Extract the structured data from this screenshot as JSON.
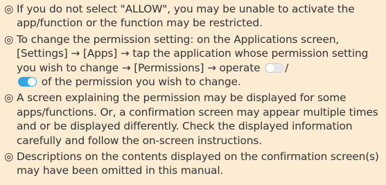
{
  "notes": {
    "mark": "◎",
    "note1": "If you do not select \"ALLOW\", you may be unable to activate the app/function or the function may be restricted.",
    "note2_before": "To change the permission setting: on the Applications screen, [Settings] → [Apps] → tap the application whose permission setting you wish to change → [Permissions] → operate",
    "note2_sep": "/",
    "note2_after": "of the permission you wish to change.",
    "note3": "A screen explaining the permission may be displayed for some apps/functions. Or, a confirmation screen may appear multiple times and or be displayed differently. Check the displayed information carefully and follow the on-screen instructions.",
    "note4": "Descriptions on the contents displayed on the confirmation screen(s) may have been omitted in this manual."
  },
  "icons": {
    "toggle_off": "toggle-off-icon",
    "toggle_on": "toggle-on-icon"
  },
  "colors": {
    "background": "#fcecd4",
    "text": "#333333",
    "toggle_on": "#35a6e6",
    "toggle_off": "#e8e8e8"
  }
}
